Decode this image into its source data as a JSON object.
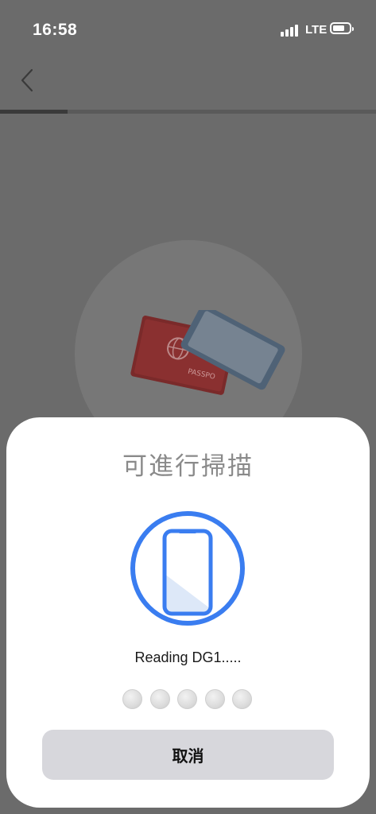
{
  "status_bar": {
    "time": "16:58",
    "network": "LTE",
    "icons": [
      "signal-icon",
      "battery-icon"
    ]
  },
  "nav": {
    "back_icon": "chevron-left-icon"
  },
  "progress": {
    "value": 0.18
  },
  "illustration": {
    "icon": "passport-phone-illustration"
  },
  "nfc_sheet": {
    "title": "可進行掃描",
    "status_text": "Reading DG1.....",
    "scan_icon": "phone-scan-icon",
    "progress_dots": 5,
    "cancel_label": "取消"
  },
  "colors": {
    "accent": "#3a7df0",
    "overlay": "#6b6b6b",
    "sheet_bg": "#ffffff",
    "button_bg": "#d7d7dc"
  }
}
